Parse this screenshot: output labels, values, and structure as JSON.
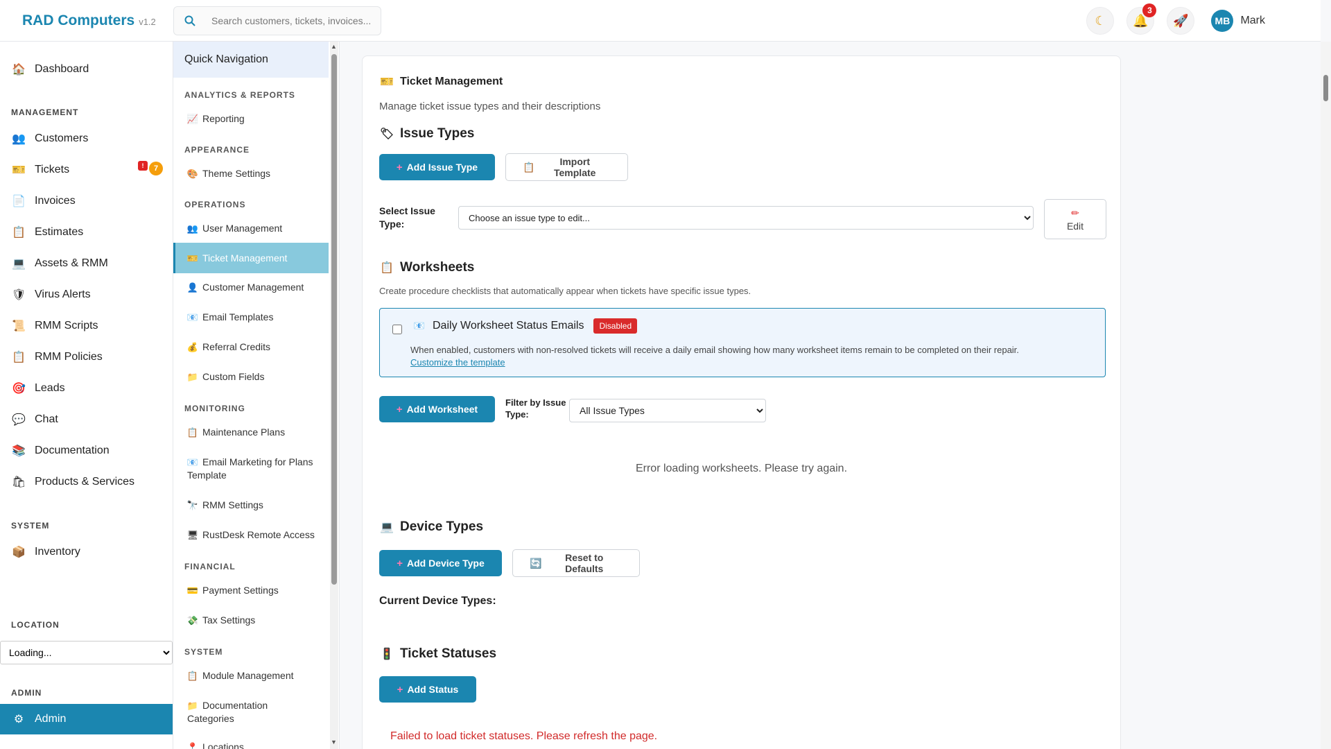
{
  "app": {
    "name": "RAD Computers",
    "version": "v1.2"
  },
  "search": {
    "placeholder": "Search customers, tickets, invoices..."
  },
  "topbar": {
    "notifications_count": "3",
    "user_initials": "MB",
    "user_name": "Mark"
  },
  "sidebar": {
    "dashboard": "Dashboard",
    "management_heading": "MANAGEMENT",
    "items": [
      "Customers",
      "Tickets",
      "Invoices",
      "Estimates",
      "Assets & RMM",
      "Virus Alerts",
      "RMM Scripts",
      "RMM Policies",
      "Leads",
      "Chat",
      "Documentation",
      "Products & Services"
    ],
    "tickets_alert_badge": "!",
    "tickets_count": "7",
    "system_heading": "SYSTEM",
    "inventory": "Inventory",
    "location_heading": "LOCATION",
    "location_value": "Loading...",
    "admin_heading": "ADMIN",
    "admin": "Admin"
  },
  "quicknav": {
    "title": "Quick Navigation",
    "sections": {
      "analytics": "ANALYTICS & REPORTS",
      "appearance": "APPEARANCE",
      "operations": "OPERATIONS",
      "monitoring": "MONITORING",
      "financial": "FINANCIAL",
      "system": "SYSTEM"
    },
    "items": {
      "reporting": "Reporting",
      "theme_settings": "Theme Settings",
      "user_management": "User Management",
      "ticket_management": "Ticket Management",
      "customer_management": "Customer Management",
      "email_templates": "Email Templates",
      "referral_credits": "Referral Credits",
      "custom_fields": "Custom Fields",
      "maintenance_plans": "Maintenance Plans",
      "email_marketing_l1": "Email Marketing for Plans",
      "email_marketing_l2": "Template",
      "rmm_settings": "RMM Settings",
      "rustdesk": "RustDesk Remote Access",
      "payment_settings": "Payment Settings",
      "tax_settings": "Tax Settings",
      "module_management": "Module Management",
      "doc_categories_l1": "Documentation",
      "doc_categories_l2": "Categories",
      "locations": "Locations"
    }
  },
  "main": {
    "title": "Ticket Management",
    "subtitle": "Manage ticket issue types and their descriptions",
    "issue_types": {
      "heading": "Issue Types",
      "add_button": "Add Issue Type",
      "import_button": "Import Template",
      "select_label_l1": "Select Issue",
      "select_label_l2": "Type:",
      "select_value": "Choose an issue type to edit...",
      "edit_button": "Edit"
    },
    "worksheets": {
      "heading": "Worksheets",
      "description": "Create procedure checklists that automatically appear when tickets have specific issue types.",
      "daily_title": "Daily Worksheet Status Emails",
      "daily_badge": "Disabled",
      "daily_description": "When enabled, customers with non-resolved tickets will receive a daily email showing how many worksheet items remain to be completed on their repair.",
      "customize_link": "Customize the template",
      "add_button": "Add Worksheet",
      "filter_label_l1": "Filter by Issue",
      "filter_label_l2": "Type:",
      "filter_value": "All Issue Types",
      "error": "Error loading worksheets. Please try again."
    },
    "device_types": {
      "heading": "Device Types",
      "add_button": "Add Device Type",
      "reset_button": "Reset to Defaults",
      "current_label": "Current Device Types:"
    },
    "ticket_statuses": {
      "heading": "Ticket Statuses",
      "add_button": "Add Status",
      "error": "Failed to load ticket statuses. Please refresh the page."
    }
  },
  "colors": {
    "accent": "#1b86b0",
    "active_nav": "#88c9dd",
    "danger": "#d92b2b",
    "badge_orange": "#f59e0b"
  }
}
